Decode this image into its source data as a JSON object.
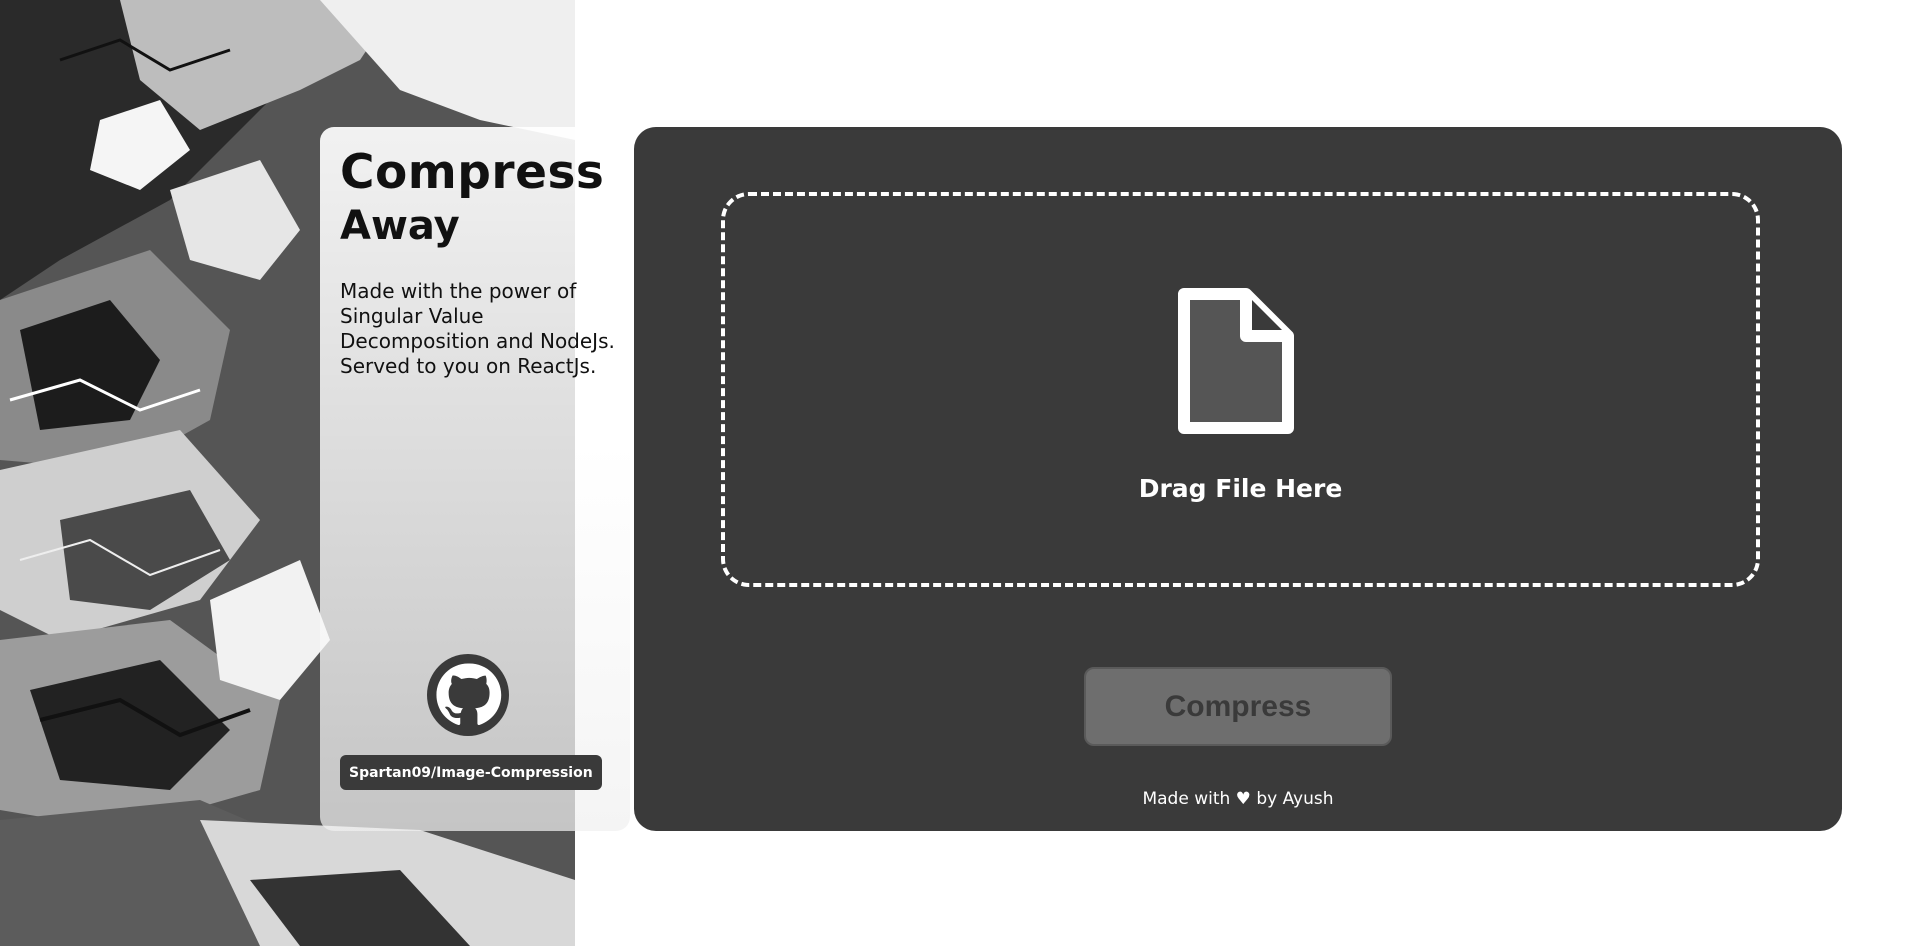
{
  "app": {
    "title_line1": "Compress",
    "title_line2": "Away",
    "description": "Made with the power of Singular Value Decomposition and NodeJs. Served to you on ReactJs.",
    "repo_link": "Spartan09/Image-Compression",
    "github_icon": "github-icon",
    "background_art": "grayscale-wolves-illustration"
  },
  "upload": {
    "file_icon": "file-icon",
    "drop_label": "Drag File Here"
  },
  "actions": {
    "compress_label": "Compress"
  },
  "footer": {
    "made_with": "Made with",
    "heart": "♥",
    "by": "by Ayush"
  },
  "colors": {
    "card": "#3a3a3a",
    "button": "#6e6e6e",
    "accent": "#ffffff"
  }
}
